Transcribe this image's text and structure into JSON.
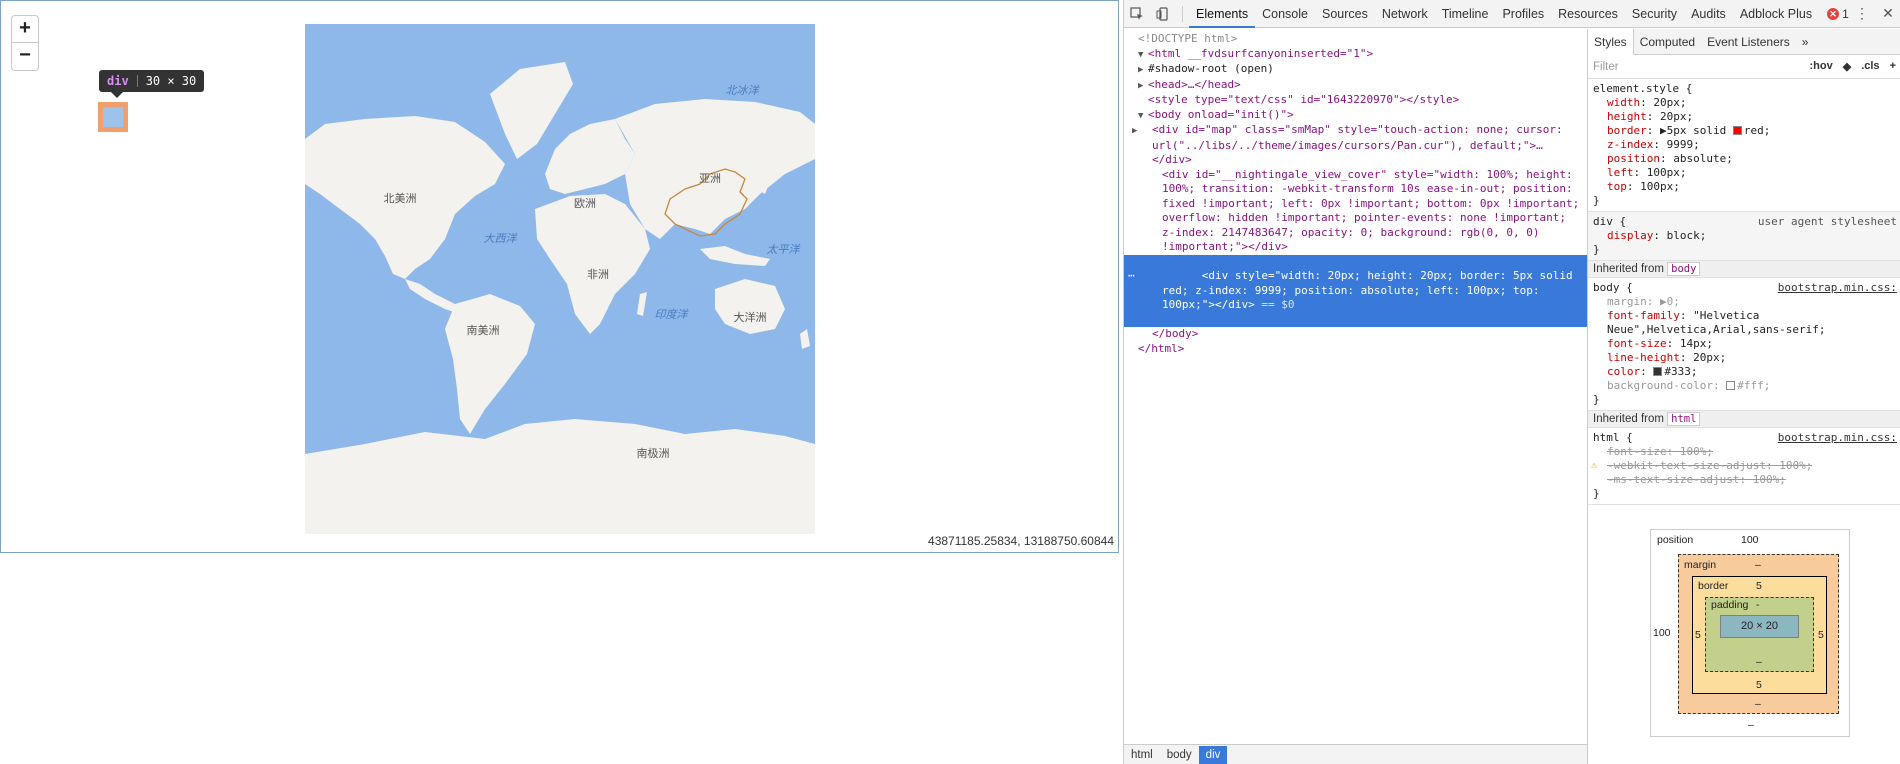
{
  "viewport": {
    "zoom_in": "+",
    "zoom_out": "−",
    "tooltip": {
      "tag": "div",
      "size": "30 × 30"
    },
    "coords": "43871185.25834, 13188750.60844",
    "map_labels": {
      "north_america": "北美洲",
      "south_america": "南美洲",
      "europe": "欧洲",
      "africa": "非洲",
      "asia": "亚洲",
      "oceania": "大洋洲",
      "antarctica": "南极洲",
      "atlantic": "大西洋",
      "arctic": "北冰洋",
      "pacific": "太平洋",
      "indian": "印度洋"
    },
    "colors": {
      "ocean": "#8fb8ea",
      "land": "#f4f2ee",
      "china_outline": "#c8873a",
      "highlight_margin": "#f2a06b",
      "highlight_content": "#9ec3ea"
    }
  },
  "devtools": {
    "tabs": [
      "Elements",
      "Console",
      "Sources",
      "Network",
      "Timeline",
      "Profiles",
      "Resources",
      "Security",
      "Audits",
      "Adblock Plus"
    ],
    "active_tab": "Elements",
    "error_count": "1",
    "dom": {
      "doctype": "<!DOCTYPE html>",
      "html_open": "<html __fvdsurfcanyoninserted=\"1\">",
      "shadow_root": "#shadow-root (open)",
      "head": "<head>…</head>",
      "style": "<style type=\"text/css\" id=\"1643220970\"></style>",
      "body_open": "<body onload=\"init()\">",
      "map_div": "<div id=\"map\" class=\"smMap\" style=\"touch-action: none; cursor: url(\"../libs/../theme/images/cursors/Pan.cur\"), default;\">…</div>",
      "cover_div": "<div id=\"__nightingale_view_cover\" style=\"width: 100%; height: 100%; transition: -webkit-transform 10s ease-in-out; position: fixed !important; left: 0px !important; bottom: 0px !important; overflow: hidden !important; pointer-events: none !important; z-index: 2147483647; opacity: 0; background: rgb(0, 0, 0) !important;\"></div>",
      "selected_div": "<div style=\"width: 20px; height: 20px; border: 5px solid red; z-index: 9999; position: absolute; left: 100px; top: 100px;\"></div>",
      "selected_suffix": " == $0",
      "body_close": "</body>",
      "html_close": "</html>"
    },
    "breadcrumbs": [
      "html",
      "body",
      "div"
    ],
    "styles_tabs": [
      "Styles",
      "Computed",
      "Event Listeners"
    ],
    "filter_placeholder": "Filter",
    "filter_actions": [
      ":hov",
      ".cls",
      "+"
    ],
    "element_style": {
      "selector": "element.style {",
      "props": [
        {
          "name": "width",
          "value": "20px;"
        },
        {
          "name": "height",
          "value": "20px;"
        },
        {
          "name": "border",
          "value": "▶5px solid ",
          "swatch": "red",
          "tail": "red;"
        },
        {
          "name": "z-index",
          "value": "9999;"
        },
        {
          "name": "position",
          "value": "absolute;"
        },
        {
          "name": "left",
          "value": "100px;"
        },
        {
          "name": "top",
          "value": "100px;"
        }
      ]
    },
    "div_rule": {
      "selector": "div {",
      "source": "user agent stylesheet",
      "prop": "display",
      "value": "block;"
    },
    "inherited_body_label": "Inherited from",
    "inherited_body_tag": "body",
    "body_rule": {
      "selector": "body {",
      "source": "bootstrap.min.css:",
      "props": [
        {
          "name": "margin",
          "value": "▶0;",
          "dim": true
        },
        {
          "name": "font-family",
          "value": "\"Helvetica Neue\",Helvetica,Arial,sans-serif;"
        },
        {
          "name": "font-size",
          "value": "14px;"
        },
        {
          "name": "line-height",
          "value": "20px;"
        },
        {
          "name": "color",
          "value": "#333;",
          "swatch": "#333333"
        },
        {
          "name": "background-color",
          "value": "#fff;",
          "swatch": "#ffffff",
          "dim": true
        }
      ]
    },
    "inherited_html_tag": "html",
    "html_rule": {
      "selector": "html {",
      "source": "bootstrap.min.css:",
      "props": [
        {
          "name": "font-size",
          "value": "100%;"
        },
        {
          "name": "-webkit-text-size-adjust",
          "value": "100%;"
        },
        {
          "name": "-ms-text-size-adjust",
          "value": "100%;"
        }
      ]
    },
    "box_model": {
      "position_label": "position",
      "position_top": "100",
      "position_left": "100",
      "position_bottom": "–",
      "margin_label": "margin",
      "margin_dash": "–",
      "border_label": "border",
      "border_value": "5",
      "padding_label": "padding",
      "padding_dash": "-",
      "content": "20 × 20",
      "dash": "–"
    }
  }
}
